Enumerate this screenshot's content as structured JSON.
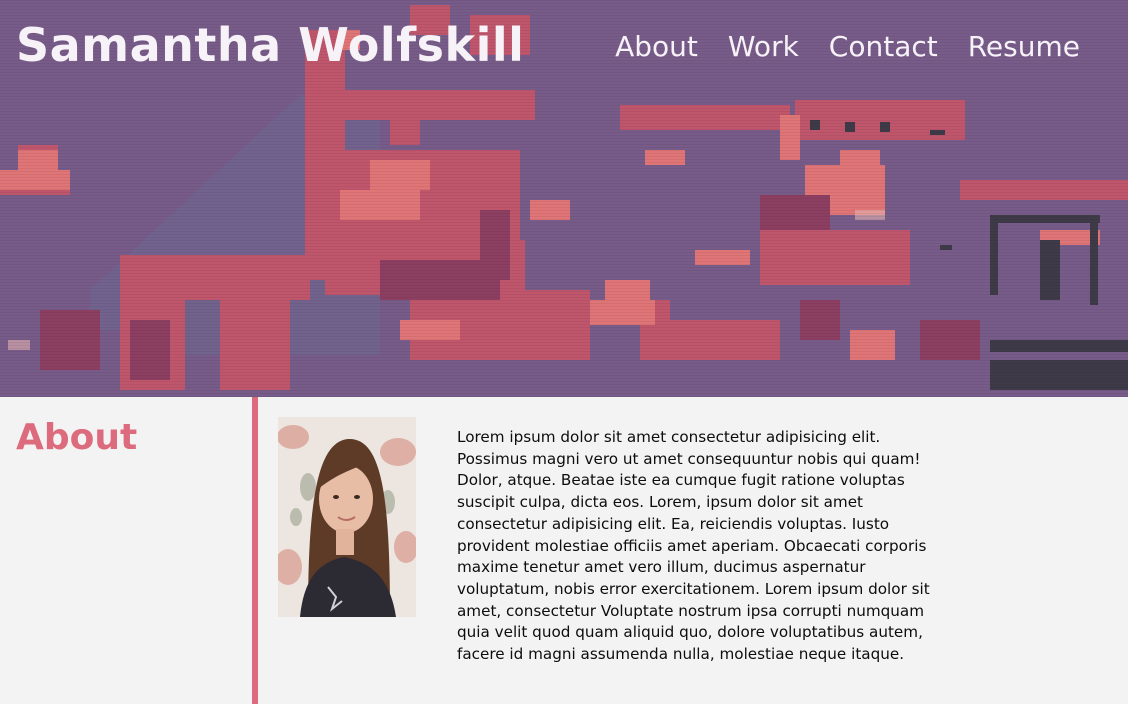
{
  "header": {
    "site_name": "Samantha Wolfskill",
    "nav": [
      "About",
      "Work",
      "Contact",
      "Resume"
    ],
    "background_color": "#775b89",
    "text_color": "#f6f2f7"
  },
  "about": {
    "title": "About",
    "accent_color": "#dc6b7d",
    "bio": "Lorem ipsum dolor sit amet consectetur adipisicing elit. Possimus magni vero ut amet consequuntur nobis qui quam! Dolor, atque. Beatae iste ea cumque fugit ratione voluptas suscipit culpa, dicta eos. Lorem, ipsum dolor sit amet consectetur adipisicing elit. Ea, reiciendis voluptas. Iusto provident molestiae officiis amet aperiam. Obcaecati corporis maxime tenetur amet vero illum, ducimus aspernatur voluptatum, nobis error exercitationem. Lorem ipsum dolor sit amet, consectetur Voluptate nostrum ipsa corrupti numquam quia velit quod quam aliquid quo, dolore voluptatibus autem, facere id magni assumenda nulla, molestiae neque itaque."
  }
}
